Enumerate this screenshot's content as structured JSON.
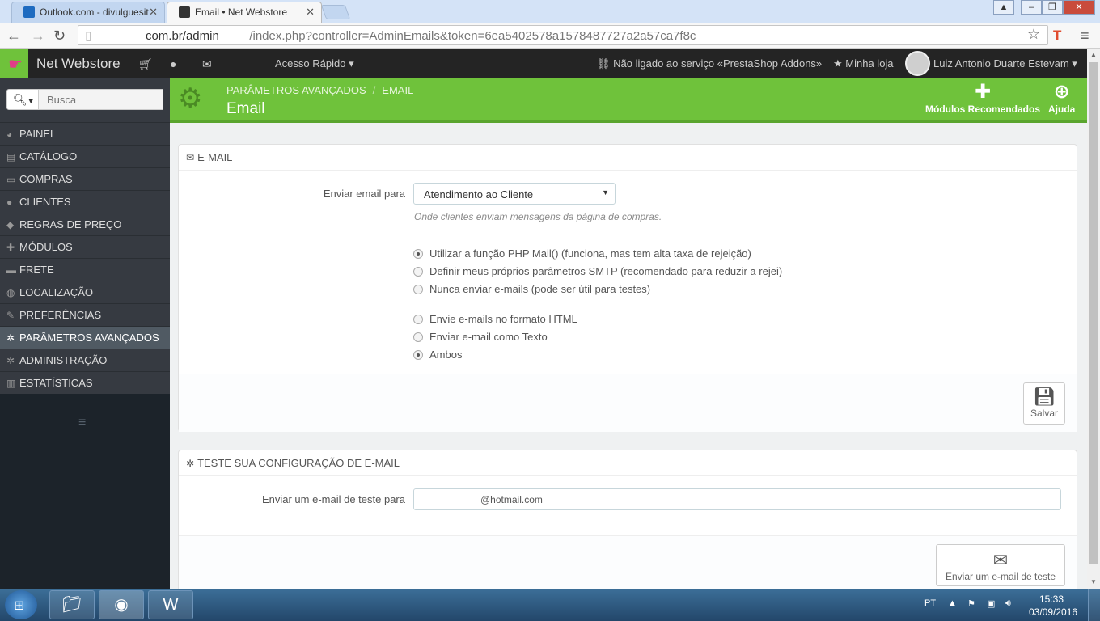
{
  "browser": {
    "tabs": [
      {
        "title": "Outlook.com - divulguesit",
        "active": false
      },
      {
        "title": "Email • Net Webstore",
        "active": true
      }
    ],
    "url_domain": "com.br/admin",
    "url_path": "/index.php?controller=AdminEmails&token=6ea5402578a1578487727a2a57ca7f8c",
    "close_glyph": "✕"
  },
  "header": {
    "shop_name": "Net Webstore",
    "quick_access": "Acesso Rápido",
    "addons_status": "Não ligado ao serviço «PrestaShop Addons»",
    "my_shop": "Minha loja",
    "user_name": "Luiz Antonio Duarte Estevam"
  },
  "sidebar": {
    "search_placeholder": "Busca",
    "items": [
      {
        "label": "PAINEL",
        "icon": "dashboard-icon",
        "glyph": "◕"
      },
      {
        "label": "CATÁLOGO",
        "icon": "book-icon",
        "glyph": "▤"
      },
      {
        "label": "COMPRAS",
        "icon": "credit-card-icon",
        "glyph": "▭"
      },
      {
        "label": "CLIENTES",
        "icon": "users-icon",
        "glyph": "●"
      },
      {
        "label": "REGRAS DE PREÇO",
        "icon": "tag-icon",
        "glyph": "◆"
      },
      {
        "label": "MÓDULOS",
        "icon": "puzzle-icon",
        "glyph": "✚"
      },
      {
        "label": "FRETE",
        "icon": "truck-icon",
        "glyph": "▬"
      },
      {
        "label": "LOCALIZAÇÃO",
        "icon": "globe-icon",
        "glyph": "◍"
      },
      {
        "label": "PREFERÊNCIAS",
        "icon": "wrench-icon",
        "glyph": "✎"
      },
      {
        "label": "PARÂMETROS AVANÇADOS",
        "icon": "cogs-icon",
        "glyph": "✲",
        "active": true
      },
      {
        "label": "ADMINISTRAÇÃO",
        "icon": "cog-icon",
        "glyph": "✲"
      },
      {
        "label": "ESTATÍSTICAS",
        "icon": "bar-chart-icon",
        "glyph": "▥"
      }
    ]
  },
  "pagehead": {
    "breadcrumb": [
      "PARÂMETROS AVANÇADOS",
      "EMAIL"
    ],
    "breadcrumb_sep": "/",
    "title": "Email",
    "toolbar": {
      "modules": "Módulos Recomendados",
      "help": "Ajuda"
    }
  },
  "email_panel": {
    "heading": "E-MAIL",
    "send_to_label": "Enviar email para",
    "send_to_value": "Atendimento ao Cliente",
    "send_to_help": "Onde clientes enviam mensagens da página de compras.",
    "method_options": [
      {
        "label": "Utilizar a função PHP Mail() (funciona, mas tem alta taxa de rejeição)",
        "checked": true
      },
      {
        "label": "Definir meus próprios parâmetros SMTP (recomendado para reduzir a rejei)",
        "checked": false
      },
      {
        "label": "Nunca enviar e-mails (pode ser útil para testes)",
        "checked": false
      }
    ],
    "format_options": [
      {
        "label": "Envie e-mails no formato HTML",
        "checked": false
      },
      {
        "label": "Enviar e-mail como Texto",
        "checked": false
      },
      {
        "label": "Ambos",
        "checked": true
      }
    ],
    "save_label": "Salvar"
  },
  "test_panel": {
    "heading": "TESTE SUA CONFIGURAÇÃO DE E-MAIL",
    "label": "Enviar um e-mail de teste para",
    "value": "@hotmail.com",
    "button_label": "Enviar um e-mail de teste"
  },
  "taskbar": {
    "language": "PT",
    "time": "15:33",
    "date": "03/09/2016"
  },
  "colors": {
    "accent_green": "#6fc23b",
    "header_dark": "#242424",
    "sidebar_bg": "#363a41"
  }
}
